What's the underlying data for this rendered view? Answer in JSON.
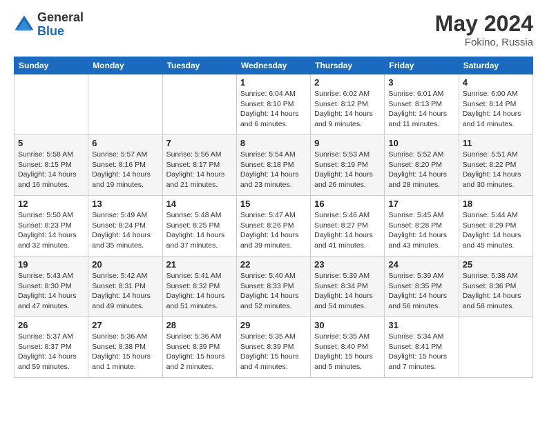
{
  "logo": {
    "general": "General",
    "blue": "Blue"
  },
  "header": {
    "month_year": "May 2024",
    "location": "Fokino, Russia"
  },
  "weekdays": [
    "Sunday",
    "Monday",
    "Tuesday",
    "Wednesday",
    "Thursday",
    "Friday",
    "Saturday"
  ],
  "weeks": [
    [
      {
        "day": "",
        "info": ""
      },
      {
        "day": "",
        "info": ""
      },
      {
        "day": "",
        "info": ""
      },
      {
        "day": "1",
        "info": "Sunrise: 6:04 AM\nSunset: 8:10 PM\nDaylight: 14 hours\nand 6 minutes."
      },
      {
        "day": "2",
        "info": "Sunrise: 6:02 AM\nSunset: 8:12 PM\nDaylight: 14 hours\nand 9 minutes."
      },
      {
        "day": "3",
        "info": "Sunrise: 6:01 AM\nSunset: 8:13 PM\nDaylight: 14 hours\nand 11 minutes."
      },
      {
        "day": "4",
        "info": "Sunrise: 6:00 AM\nSunset: 8:14 PM\nDaylight: 14 hours\nand 14 minutes."
      }
    ],
    [
      {
        "day": "5",
        "info": "Sunrise: 5:58 AM\nSunset: 8:15 PM\nDaylight: 14 hours\nand 16 minutes."
      },
      {
        "day": "6",
        "info": "Sunrise: 5:57 AM\nSunset: 8:16 PM\nDaylight: 14 hours\nand 19 minutes."
      },
      {
        "day": "7",
        "info": "Sunrise: 5:56 AM\nSunset: 8:17 PM\nDaylight: 14 hours\nand 21 minutes."
      },
      {
        "day": "8",
        "info": "Sunrise: 5:54 AM\nSunset: 8:18 PM\nDaylight: 14 hours\nand 23 minutes."
      },
      {
        "day": "9",
        "info": "Sunrise: 5:53 AM\nSunset: 8:19 PM\nDaylight: 14 hours\nand 26 minutes."
      },
      {
        "day": "10",
        "info": "Sunrise: 5:52 AM\nSunset: 8:20 PM\nDaylight: 14 hours\nand 28 minutes."
      },
      {
        "day": "11",
        "info": "Sunrise: 5:51 AM\nSunset: 8:22 PM\nDaylight: 14 hours\nand 30 minutes."
      }
    ],
    [
      {
        "day": "12",
        "info": "Sunrise: 5:50 AM\nSunset: 8:23 PM\nDaylight: 14 hours\nand 32 minutes."
      },
      {
        "day": "13",
        "info": "Sunrise: 5:49 AM\nSunset: 8:24 PM\nDaylight: 14 hours\nand 35 minutes."
      },
      {
        "day": "14",
        "info": "Sunrise: 5:48 AM\nSunset: 8:25 PM\nDaylight: 14 hours\nand 37 minutes."
      },
      {
        "day": "15",
        "info": "Sunrise: 5:47 AM\nSunset: 8:26 PM\nDaylight: 14 hours\nand 39 minutes."
      },
      {
        "day": "16",
        "info": "Sunrise: 5:46 AM\nSunset: 8:27 PM\nDaylight: 14 hours\nand 41 minutes."
      },
      {
        "day": "17",
        "info": "Sunrise: 5:45 AM\nSunset: 8:28 PM\nDaylight: 14 hours\nand 43 minutes."
      },
      {
        "day": "18",
        "info": "Sunrise: 5:44 AM\nSunset: 8:29 PM\nDaylight: 14 hours\nand 45 minutes."
      }
    ],
    [
      {
        "day": "19",
        "info": "Sunrise: 5:43 AM\nSunset: 8:30 PM\nDaylight: 14 hours\nand 47 minutes."
      },
      {
        "day": "20",
        "info": "Sunrise: 5:42 AM\nSunset: 8:31 PM\nDaylight: 14 hours\nand 49 minutes."
      },
      {
        "day": "21",
        "info": "Sunrise: 5:41 AM\nSunset: 8:32 PM\nDaylight: 14 hours\nand 51 minutes."
      },
      {
        "day": "22",
        "info": "Sunrise: 5:40 AM\nSunset: 8:33 PM\nDaylight: 14 hours\nand 52 minutes."
      },
      {
        "day": "23",
        "info": "Sunrise: 5:39 AM\nSunset: 8:34 PM\nDaylight: 14 hours\nand 54 minutes."
      },
      {
        "day": "24",
        "info": "Sunrise: 5:39 AM\nSunset: 8:35 PM\nDaylight: 14 hours\nand 56 minutes."
      },
      {
        "day": "25",
        "info": "Sunrise: 5:38 AM\nSunset: 8:36 PM\nDaylight: 14 hours\nand 58 minutes."
      }
    ],
    [
      {
        "day": "26",
        "info": "Sunrise: 5:37 AM\nSunset: 8:37 PM\nDaylight: 14 hours\nand 59 minutes."
      },
      {
        "day": "27",
        "info": "Sunrise: 5:36 AM\nSunset: 8:38 PM\nDaylight: 15 hours\nand 1 minute."
      },
      {
        "day": "28",
        "info": "Sunrise: 5:36 AM\nSunset: 8:39 PM\nDaylight: 15 hours\nand 2 minutes."
      },
      {
        "day": "29",
        "info": "Sunrise: 5:35 AM\nSunset: 8:39 PM\nDaylight: 15 hours\nand 4 minutes."
      },
      {
        "day": "30",
        "info": "Sunrise: 5:35 AM\nSunset: 8:40 PM\nDaylight: 15 hours\nand 5 minutes."
      },
      {
        "day": "31",
        "info": "Sunrise: 5:34 AM\nSunset: 8:41 PM\nDaylight: 15 hours\nand 7 minutes."
      },
      {
        "day": "",
        "info": ""
      }
    ]
  ]
}
